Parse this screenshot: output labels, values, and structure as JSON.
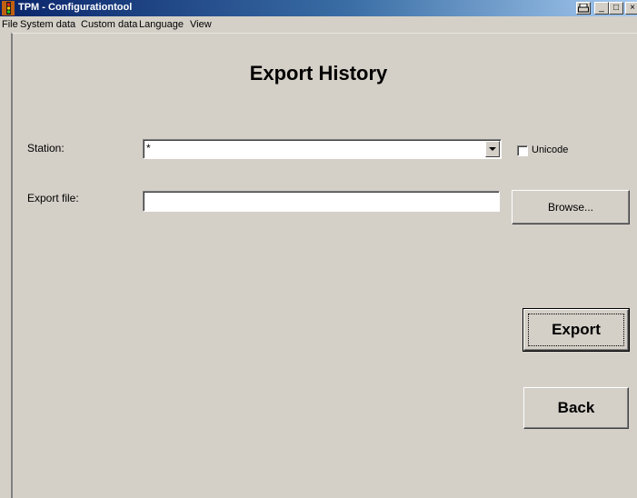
{
  "window": {
    "title": "TPM - Configurationtool",
    "controls": {
      "minimize": "_",
      "maximize": "□",
      "close": "×"
    }
  },
  "menu": {
    "items": [
      {
        "label": "File"
      },
      {
        "label": "System data"
      },
      {
        "label": "Custom data"
      },
      {
        "label": "Language"
      },
      {
        "label": "View"
      }
    ]
  },
  "page": {
    "title": "Export History"
  },
  "form": {
    "station_label": "Station:",
    "station_value": "*",
    "unicode_label": "Unicode",
    "unicode_checked": false,
    "export_file_label": "Export file:",
    "export_file_value": "",
    "browse_label": "Browse..."
  },
  "actions": {
    "export_label": "Export",
    "back_label": "Back"
  },
  "colors": {
    "face": "#d4d0c8",
    "titlebar_start": "#0a246a",
    "titlebar_end": "#a6caf0"
  }
}
